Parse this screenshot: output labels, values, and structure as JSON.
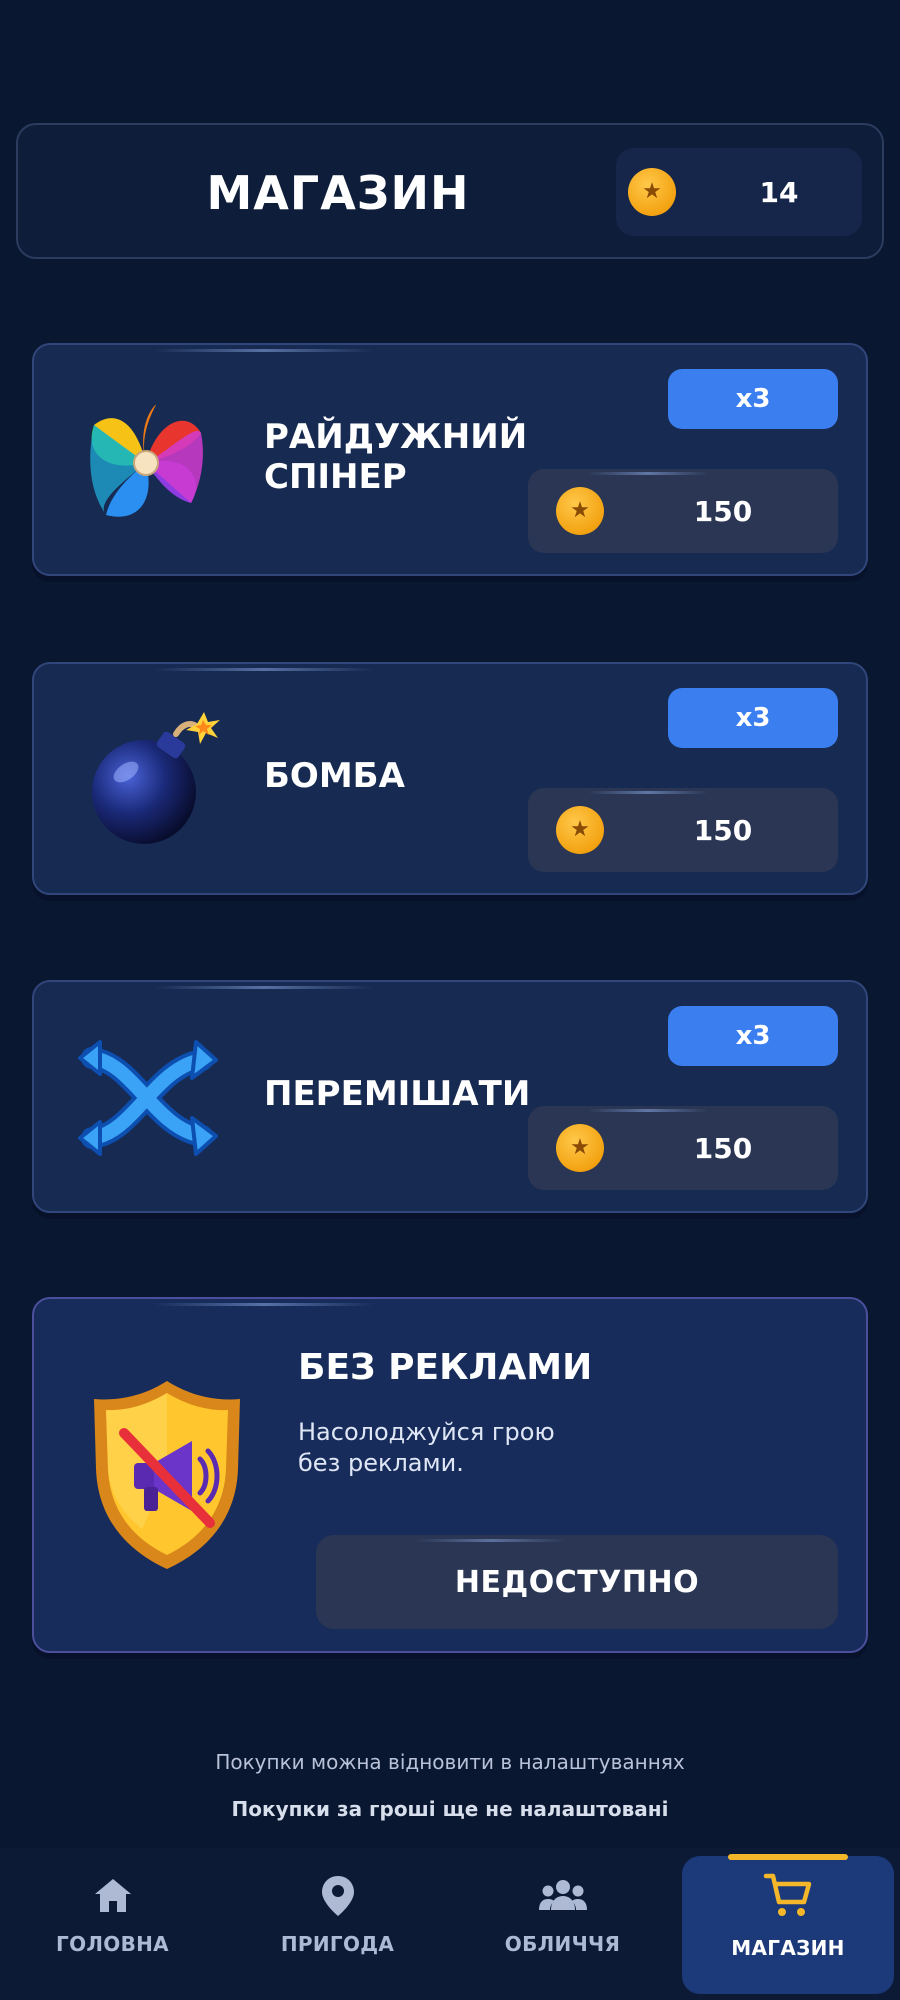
{
  "header": {
    "title": "МАГАЗИН",
    "coins": "14"
  },
  "items": [
    {
      "name": "РАЙДУЖНИЙ\nСПІНЕР",
      "qty": "x3",
      "price": "150",
      "icon": "rainbow-spinner-icon"
    },
    {
      "name": "БОМБА",
      "qty": "x3",
      "price": "150",
      "icon": "bomb-icon"
    },
    {
      "name": "ПЕРЕМІШАТИ",
      "qty": "x3",
      "price": "150",
      "icon": "shuffle-icon"
    }
  ],
  "no_ads": {
    "title": "БЕЗ РЕКЛАМИ",
    "description": "Насолоджуйся грою\nбез реклами.",
    "button": "НЕДОСТУПНО",
    "icon": "no-ads-shield-icon"
  },
  "notes": {
    "restore": "Покупки можна відновити в налаштуваннях",
    "not_configured": "Покупки за гроші ще не налаштовані"
  },
  "nav": {
    "items": [
      {
        "label": "ГОЛОВНА",
        "icon": "home-icon"
      },
      {
        "label": "ПРИГОДА",
        "icon": "map-pin-icon"
      },
      {
        "label": "ОБЛИЧЧЯ",
        "icon": "people-icon"
      },
      {
        "label": "МАГАЗИН",
        "icon": "cart-icon"
      }
    ],
    "active_index": 3
  },
  "colors": {
    "background": "#0a1730",
    "card": "#172a51",
    "accent_blue": "#3a7ef0",
    "coin_gold": "#f3a312",
    "active_tab": "#1c3a7a"
  }
}
